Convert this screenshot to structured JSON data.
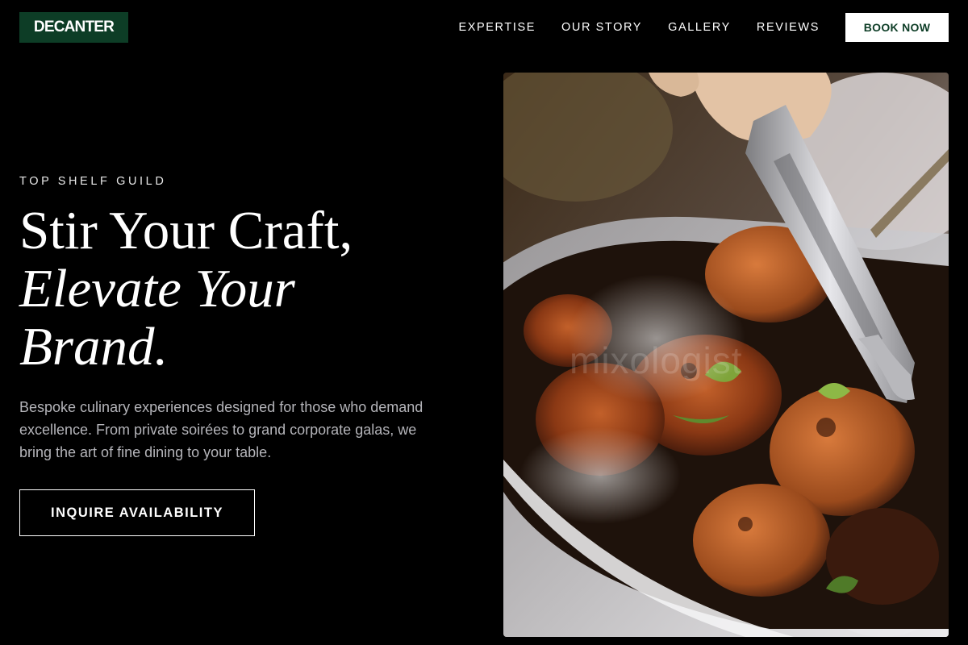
{
  "brand": {
    "logo_text": "DECANTER"
  },
  "nav": {
    "items": [
      "EXPERTISE",
      "OUR STORY",
      "GALLERY",
      "REVIEWS"
    ],
    "cta_label": "BOOK NOW"
  },
  "hero": {
    "eyebrow": "TOP SHELF GUILD",
    "headline_line1": "Stir Your Craft,",
    "headline_line2": "Elevate Your",
    "headline_line3": "Brand.",
    "description": "Bespoke culinary experiences designed for those who demand excellence. From private soirées to grand corporate galas, we bring the art of fine dining to your table.",
    "cta_label": "INQUIRE AVAILABILITY",
    "image_watermark": "mixologist"
  },
  "colors": {
    "background": "#000000",
    "brand_green": "#0d3d26",
    "text_muted": "#b4b4b9"
  }
}
